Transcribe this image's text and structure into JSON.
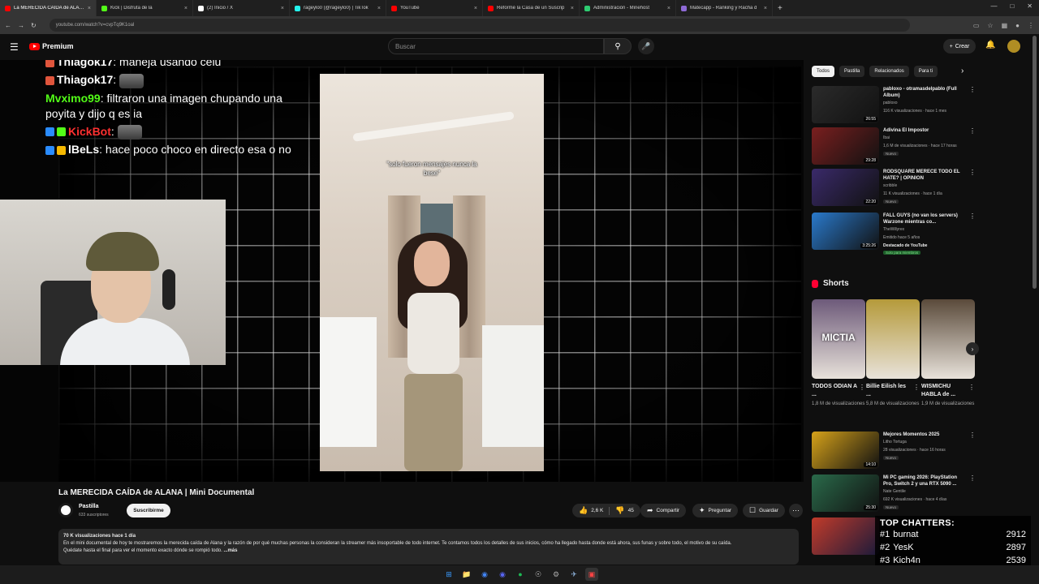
{
  "browser": {
    "tabs": [
      {
        "label": "La MERECIDA CAÍDA de ALANA",
        "active": true,
        "color": "#ff0000"
      },
      {
        "label": "Kick | Disfruta de la",
        "active": false,
        "color": "#53fc18"
      },
      {
        "label": "(2) Inicio / X",
        "active": false,
        "color": "#ffffff"
      },
      {
        "label": "rageylo0 (@rageylo0) | TikTok",
        "active": false,
        "color": "#25f4ee"
      },
      {
        "label": "YouTube",
        "active": false,
        "color": "#ff0000"
      },
      {
        "label": "Reformé la Casa de un Suscrip",
        "active": false,
        "color": "#ff0000"
      },
      {
        "label": "Administración - Minehost",
        "active": false,
        "color": "#2ecc71"
      },
      {
        "label": "Matecapp - Ranking y Racha d",
        "active": false,
        "color": "#8e6ad6"
      }
    ],
    "new_tab": "+",
    "url": "youtube.com/watch?v=cvpTq9K1oal"
  },
  "yt_header": {
    "logo_label": "Premium",
    "search_placeholder": "Buscar",
    "create_label": "Crear"
  },
  "stream": {
    "chat": [
      {
        "user": "lBeLs",
        "color": "#ffffff",
        "text": "",
        "badges": [
          "#2a8cff",
          "#f5b800"
        ]
      },
      {
        "user": "Thiagok17",
        "color": "#ffffff",
        "text": ": maneja usando celu",
        "badges": [
          "#e0553c"
        ]
      },
      {
        "user": "Thiagok17",
        "color": "#ffffff",
        "text": ":",
        "badges": [
          "#e0553c"
        ]
      },
      {
        "user": "Mvximo99",
        "color": "#53fc18",
        "text": ": filtraron una imagen chupando una poyita y dijo q es ia",
        "badges": []
      },
      {
        "user": "KickBot",
        "color": "#ff3030",
        "text": ":",
        "badges": [
          "#2a8cff",
          "#53fc18"
        ]
      },
      {
        "user": "lBeLs",
        "color": "#ffffff",
        "text": ": hace poco choco en directo esa o no",
        "badges": [
          "#2a8cff",
          "#f5b800"
        ]
      }
    ],
    "tiktok_caption": "\"solo fueron mensajes nunca la bese\""
  },
  "video": {
    "title": "La MERECIDA CAÍDA de ALANA | Mini Documental",
    "channel": "Pastilla",
    "subscribers": "633 suscriptores",
    "subscribe_label": "Suscribirme",
    "likes": "2,6 K",
    "dislikes": "45",
    "share_label": "Compartir",
    "ask_label": "Preguntar",
    "save_label": "Guardar",
    "description_meta": "70 K visualizaciones  hace 1 día",
    "description_text": "En el mini documental de hoy te mostraremos la merecida caída de Alana y la razón de por qué muchas personas la consideran la streamer más insoportable de todo internet. Te contamos todos los detalles de sus inicios, cómo ha llegado hasta donde está ahora, sus funas y sobre todo, el motivo de su caída.",
    "description_text2": "Quédate hasta el final para ver el momento exacto dónde se rompió todo.",
    "more_label": "...más"
  },
  "sidebar": {
    "chips": [
      "Todos",
      "Pastilla",
      "Relacionados",
      "Para ti"
    ],
    "recs_top": [
      {
        "title": "pabloxo - otramasdelpablo (Full Album)",
        "channel": "pabloxo",
        "meta": "116 K visualizaciones · hace 1 mes",
        "duration": "26:55",
        "badge": "",
        "thumb": "#2b2b2b"
      },
      {
        "title": "Adivina El Impostor",
        "channel": "Ibai",
        "meta": "1,6 M de visualizaciones · hace 17 horas",
        "duration": "29:28",
        "badge": "Nuevo",
        "thumb": "#7a1f1f"
      },
      {
        "title": "RODSQUARE MERECE TODO EL HATE? | OPINION",
        "channel": "scribble",
        "meta": "11 K visualizaciones · hace 1 día",
        "duration": "22:20",
        "badge": "Nuevo",
        "thumb": "#3a2a6a"
      },
      {
        "title": "FALL GUYS (no van los servers) Warzone mientras co...",
        "channel": "TheWillyrex",
        "meta": "Emitido hace 5 años",
        "duration": "3:25:26",
        "badge": "",
        "extra": "Destacado de YouTube",
        "extra2": "Solo para miembros",
        "thumb": "#2a7acc"
      }
    ],
    "shorts_title": "Shorts",
    "shorts": [
      {
        "title": "TODOS ODIAN A ...",
        "views": "1,8 M de visualizaciones",
        "overlay": "MICTIA",
        "thumb": "#6d5a7a"
      },
      {
        "title": "Billie Eilish les ...",
        "views": "5,8 M de visualizaciones",
        "overlay": "",
        "thumb": "#b59a3a"
      },
      {
        "title": "WISMICHU HABLA de ...",
        "views": "1,9 M de visualizaciones",
        "overlay": "",
        "thumb": "#5a4a3a"
      }
    ],
    "recs_bottom": [
      {
        "title": "Mejores Momentos 2025",
        "channel": "Litho Tortuga",
        "meta": "28 visualizaciones · hace 16 horas",
        "duration": "14:10",
        "badge": "Nuevo",
        "thumb": "#d6a21a"
      },
      {
        "title": "Mi PC gaming 2026: PlayStation Pro, Switch 2 y una RTX 5090 ...",
        "channel": "Nate Gentile",
        "meta": "692 K visualizaciones · hace 4 días",
        "duration": "25:30",
        "badge": "Nuevo",
        "thumb": "#2a6a4a"
      }
    ]
  },
  "top_chatters": {
    "heading": "TOP CHATTERS:",
    "rows": [
      {
        "rank": "#1",
        "name": "burnat",
        "count": "2912"
      },
      {
        "rank": "#2",
        "name": "YesK",
        "count": "2897"
      },
      {
        "rank": "#3",
        "name": "Kich4n",
        "count": "2539"
      }
    ]
  }
}
